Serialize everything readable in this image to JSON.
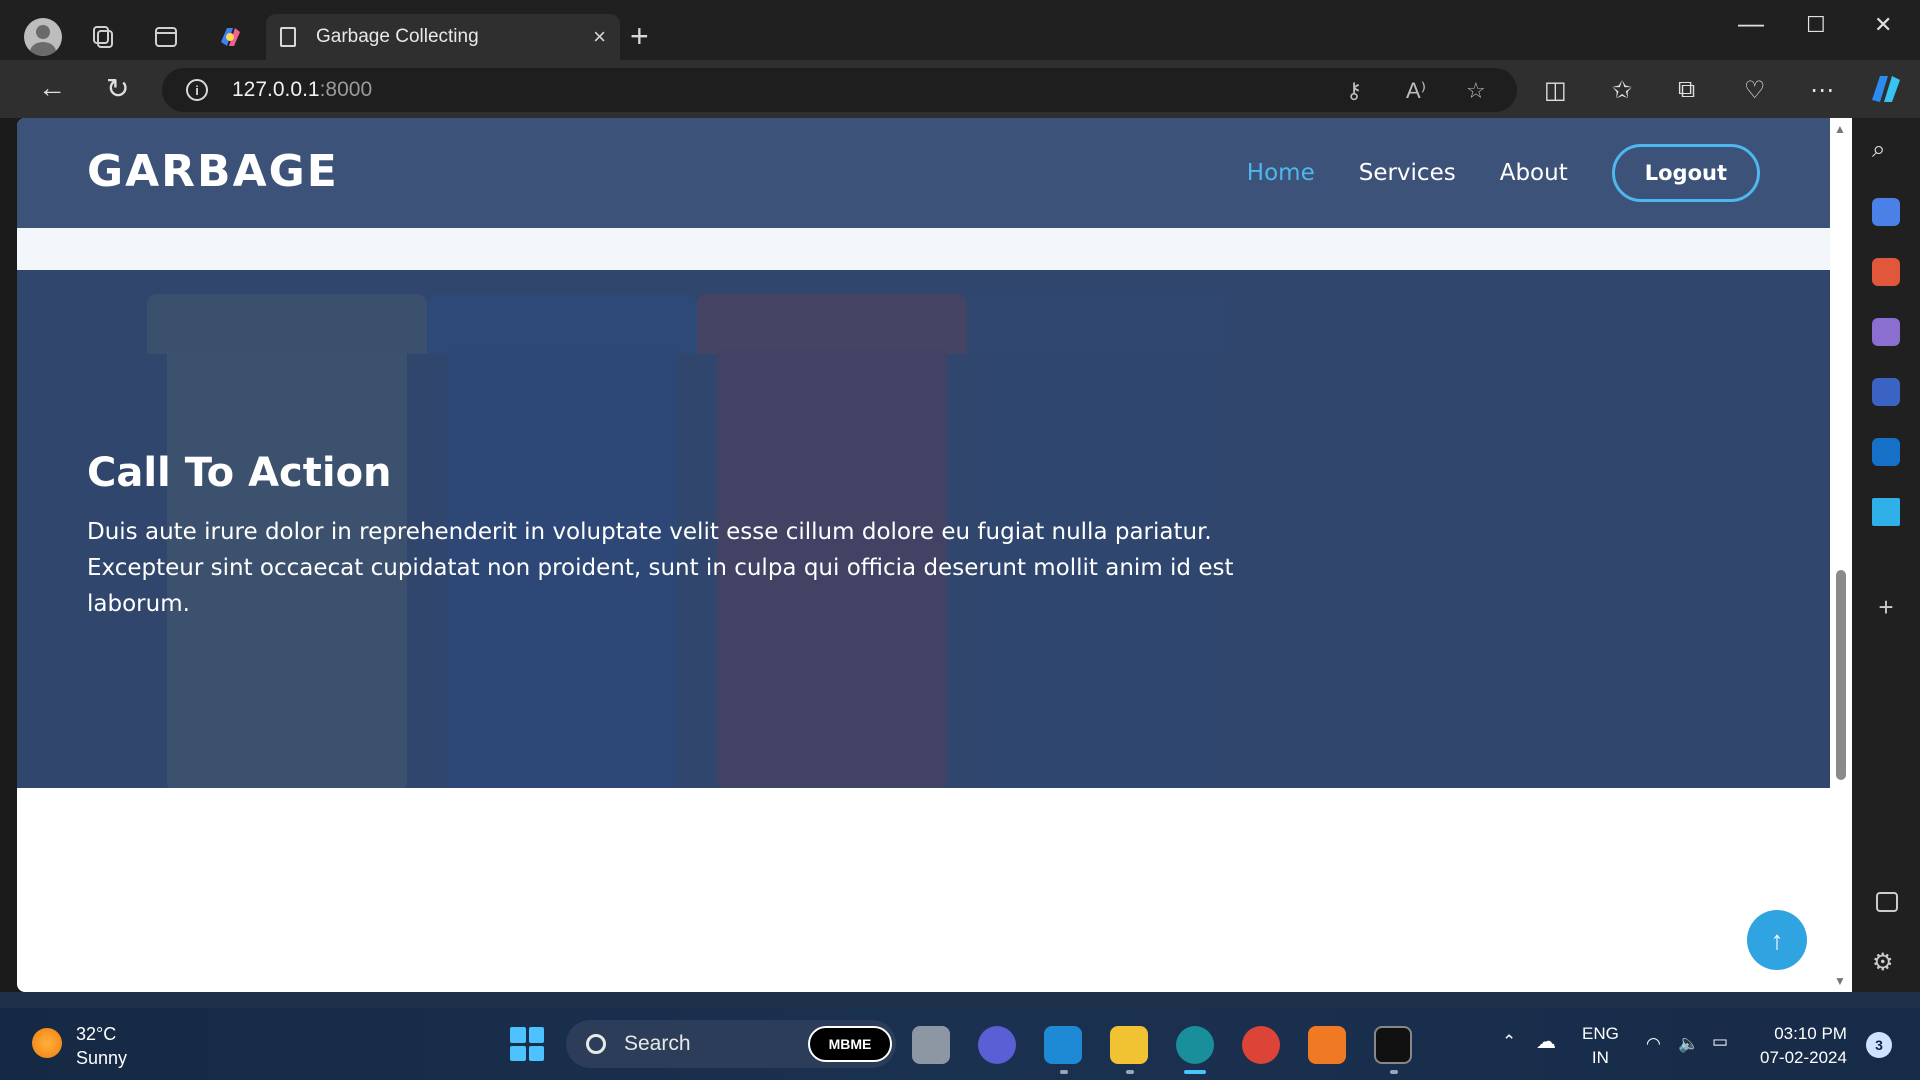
{
  "browser": {
    "tab_title": "Garbage Collecting",
    "url_host": "127.0.0.1",
    "url_port": ":8000",
    "new_tab_symbol": "+",
    "close_tab_symbol": "×"
  },
  "site": {
    "logo": "GARBAGE",
    "nav": {
      "home": "Home",
      "services": "Services",
      "about": "About",
      "logout": "Logout"
    },
    "cta": {
      "title": "Call To Action",
      "text": "Duis aute irure dolor in reprehenderit in voluptate velit esse cillum dolore eu fugiat nulla pariatur. Excepteur sint occaecat cupidatat non proident, sunt in culpa qui officia deserunt mollit anim id est laborum."
    },
    "colors": {
      "header_bg": "#3d5278",
      "accent": "#4fb6ee",
      "cta_overlay": "#30456d"
    }
  },
  "taskbar": {
    "weather_temp": "32°C",
    "weather_desc": "Sunny",
    "search_label": "Search",
    "mbme_label": "MBME",
    "lang_line1": "ENG",
    "lang_line2": "IN",
    "time": "03:10 PM",
    "date": "07-02-2024",
    "notification_count": "3"
  }
}
